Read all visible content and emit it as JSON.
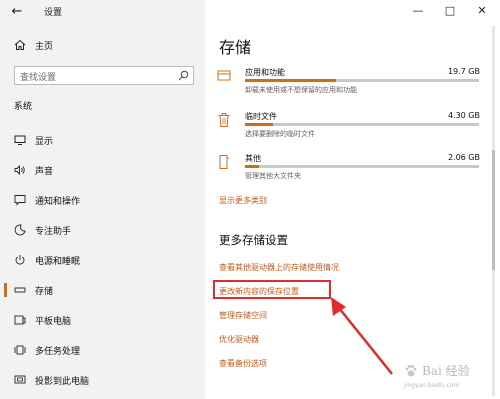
{
  "window": {
    "app_title": "设置",
    "back_glyph": "←",
    "minimize_glyph": "—",
    "maximize_glyph": "□",
    "close_glyph": "✕"
  },
  "sidebar": {
    "home_label": "主页",
    "search_placeholder": "查找设置",
    "section_label": "系统",
    "items": [
      {
        "label": "显示",
        "icon": "display-icon"
      },
      {
        "label": "声音",
        "icon": "sound-icon"
      },
      {
        "label": "通知和操作",
        "icon": "notification-icon"
      },
      {
        "label": "专注助手",
        "icon": "focus-assist-icon"
      },
      {
        "label": "电源和睡眠",
        "icon": "power-icon"
      },
      {
        "label": "存储",
        "icon": "storage-icon",
        "active": true
      },
      {
        "label": "平板电脑",
        "icon": "tablet-icon"
      },
      {
        "label": "多任务处理",
        "icon": "multitasking-icon"
      },
      {
        "label": "投影到此电脑",
        "icon": "projection-icon"
      }
    ]
  },
  "main": {
    "title": "存储",
    "storage": [
      {
        "name": "应用和功能",
        "size": "19.7 GB",
        "desc": "卸载未使用或不想保留的应用和功能",
        "usage": 0.39,
        "icon": "apps-icon"
      },
      {
        "name": "临时文件",
        "size": "4.30 GB",
        "desc": "选择要删除的临时文件",
        "usage": 0.12,
        "icon": "trash-icon"
      },
      {
        "name": "其他",
        "size": "2.06 GB",
        "desc": "管理其他大文件夹",
        "usage": 0.06,
        "icon": "folder-icon"
      }
    ],
    "show_more": "显示更多类别",
    "more_settings_header": "更多存储设置",
    "links": [
      "查看其他驱动器上的存储使用情况",
      "更改新内容的保存位置",
      "管理存储空间",
      "优化驱动器",
      "查看备份选项"
    ]
  },
  "watermark": {
    "title": "Bai 经验",
    "url": "jingyan.baidu.com"
  },
  "colors": {
    "accent": "#cc6d1a",
    "link": "#c2591a",
    "highlight": "#e02b2b",
    "sidebar_bg": "#f2f2f2"
  }
}
